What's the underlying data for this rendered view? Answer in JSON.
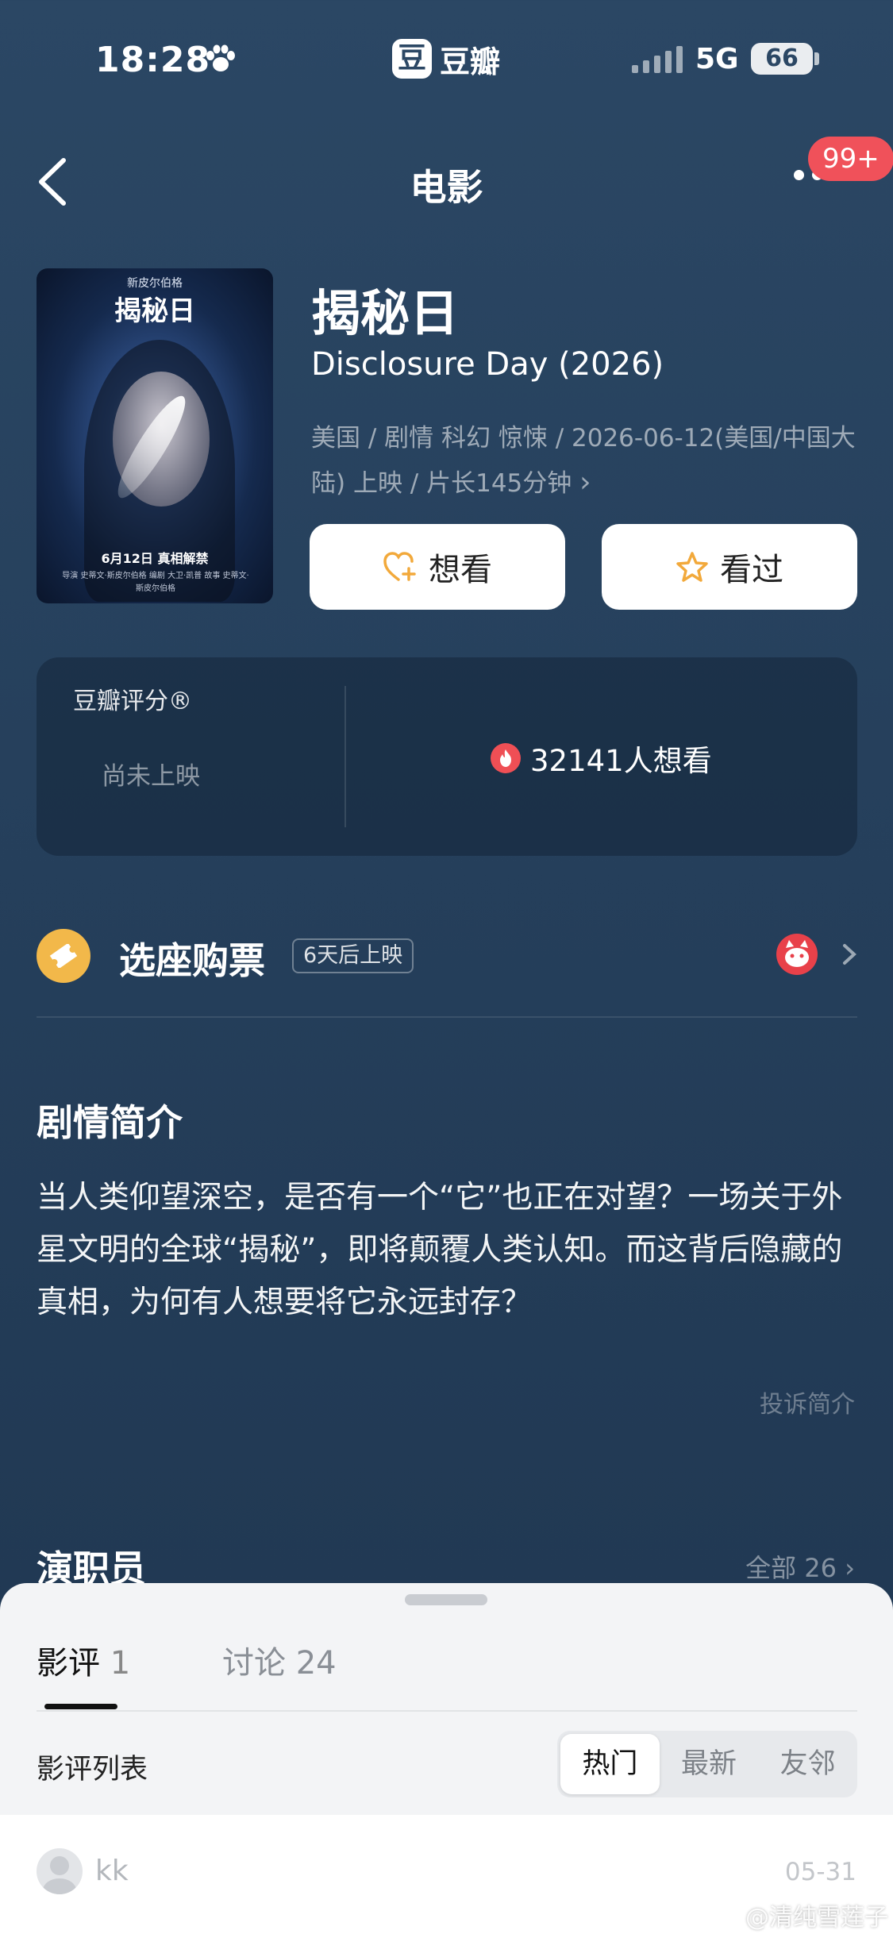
{
  "status_bar": {
    "time": "18:28",
    "app_name": "豆瓣",
    "app_logo_char": "豆",
    "network": "5G",
    "battery": "66"
  },
  "nav": {
    "title": "电影",
    "notification_badge": "99+"
  },
  "poster": {
    "top_text": "新皮尔伯格",
    "title": "揭秘日",
    "date_text": "6月12日 真相解禁",
    "credits": "导演 史蒂文·斯皮尔伯格 编剧 大卫·凯普 故事 史蒂文·斯皮尔伯格"
  },
  "movie": {
    "title": "揭秘日",
    "english_title": "Disclosure Day (2026)",
    "meta": "美国 / 剧情 科幻 惊悚 / 2026-06-12(美国/中国大陆) 上映 / 片长145分钟",
    "meta_chevron": "›",
    "want_label": "想看",
    "seen_label": "看过"
  },
  "rating": {
    "label": "豆瓣评分®",
    "status": "尚未上映",
    "want_count": "32141人想看"
  },
  "ticket": {
    "label": "选座购票",
    "badge": "6天后上映"
  },
  "synopsis": {
    "title": "剧情简介",
    "text": "当人类仰望深空，是否有一个“它”也正在对望？一场关于外星文明的全球“揭秘”，即将颠覆人类认知。而这背后隐藏的真相，为何有人想要将它永远封存？",
    "report": "投诉简介"
  },
  "cast": {
    "title": "演职员",
    "all": "全部 26 ›"
  },
  "sheet": {
    "tabs": [
      {
        "label": "影评",
        "count": "1"
      },
      {
        "label": "讨论",
        "count": "24"
      }
    ],
    "list_label": "影评列表",
    "sort_options": [
      "热门",
      "最新",
      "友邻"
    ],
    "review": {
      "user": "kk",
      "date": "05-31"
    }
  },
  "watermark": "@清纯雪莲子",
  "colors": {
    "background": "#2b4764",
    "accent_orange": "#f2b84a",
    "badge_red": "#f0515a",
    "sheet_bg": "#f3f4f6"
  }
}
